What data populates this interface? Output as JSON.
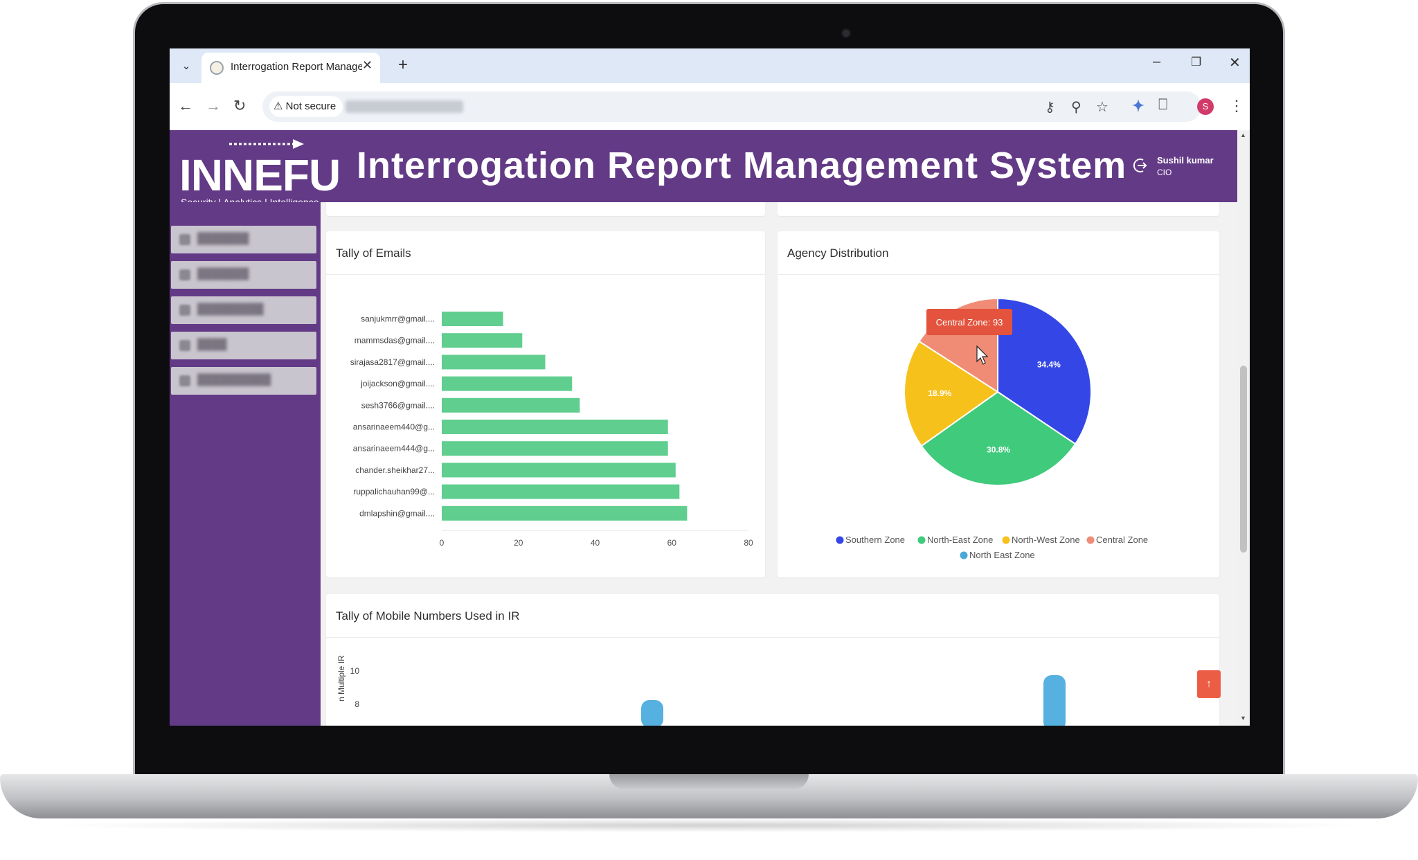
{
  "browser": {
    "tab_title": "Interrogation Report Managem",
    "security_label": "Not secure",
    "profile_initial": "S",
    "icons": [
      "tab-list-icon",
      "close-icon",
      "plus-icon",
      "minimize-icon",
      "restore-icon",
      "back-icon",
      "forward-icon",
      "reload-icon",
      "warning-icon",
      "password-key-icon",
      "zoom-icon",
      "star-icon",
      "extension-puzzle-icon",
      "more-vert-icon"
    ]
  },
  "app": {
    "logo": "INNEFU",
    "tagline": "Security | Analytics | Intelligence",
    "title": "Interrogation Report Management System",
    "user": {
      "name": "Sushil kumar",
      "role": "CIO"
    },
    "brand_color": "#633a86"
  },
  "emails_card": {
    "title": "Tally of Emails"
  },
  "agency_card": {
    "title": "Agency Distribution",
    "tooltip": "Central Zone: 93"
  },
  "mobile_card": {
    "title": "Tally of Mobile Numbers Used in IR",
    "ylabel": "n Multiple IR",
    "ticks": [
      "10",
      "8"
    ]
  },
  "chart_data": [
    {
      "type": "bar",
      "orientation": "horizontal",
      "title": "Tally of Emails",
      "categories": [
        "sanjukmrr@gmail....",
        "mammsdas@gmail....",
        "sirajasa2817@gmail....",
        "joijackson@gmail....",
        "sesh3766@gmail....",
        "ansarinaeem440@g...",
        "ansarinaeem444@g...",
        "chander.sheikhar27...",
        "ruppalichauhan99@...",
        "dmlapshin@gmail...."
      ],
      "values": [
        16,
        21,
        27,
        34,
        36,
        59,
        59,
        61,
        62,
        64
      ],
      "xlim": [
        0,
        80
      ],
      "xticks": [
        "0",
        "20",
        "40",
        "60",
        "80"
      ],
      "color": "#5fce8f"
    },
    {
      "type": "pie",
      "title": "Agency Distribution",
      "labels": [
        "Southern Zone",
        "North-East Zone",
        "North-West Zone",
        "Central Zone",
        "North East Zone"
      ],
      "values": [
        34.4,
        30.8,
        18.9,
        15.9,
        0
      ],
      "value_labels": [
        "34.4%",
        "30.8%",
        "18.9%",
        "",
        ""
      ],
      "colors": [
        "#3447e6",
        "#3fca7c",
        "#f7c11c",
        "#f08c75",
        "#4aa8d8"
      ],
      "legend_position": "bottom"
    }
  ]
}
